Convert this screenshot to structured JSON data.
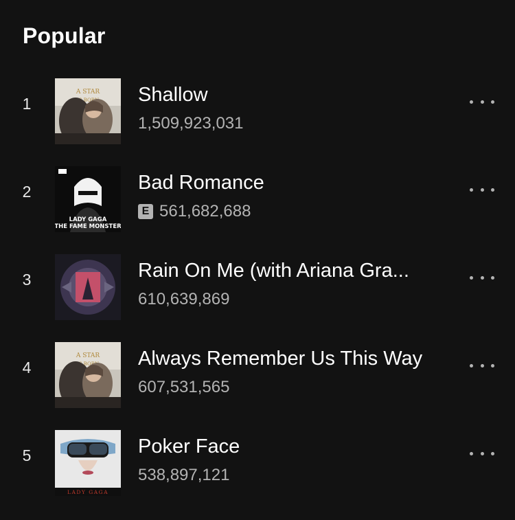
{
  "section": {
    "title": "Popular"
  },
  "tracks": [
    {
      "rank": "1",
      "title": "Shallow",
      "plays": "1,509,923,031",
      "explicit": false,
      "cover": "a-star-is-born"
    },
    {
      "rank": "2",
      "title": "Bad Romance",
      "plays": "561,682,688",
      "explicit": true,
      "explicit_label": "E",
      "cover": "the-fame-monster",
      "cover_text": [
        "LADY GAGA",
        "THE FAME MONSTER"
      ]
    },
    {
      "rank": "3",
      "title": "Rain On Me (with Ariana Gra...",
      "plays": "610,639,869",
      "explicit": false,
      "cover": "chromatica"
    },
    {
      "rank": "4",
      "title": "Always Remember Us This Way",
      "plays": "607,531,565",
      "explicit": false,
      "cover": "a-star-is-born"
    },
    {
      "rank": "5",
      "title": "Poker Face",
      "plays": "538,897,121",
      "explicit": false,
      "cover": "the-fame",
      "cover_text": [
        "LADY GAGA"
      ]
    }
  ],
  "icons": {
    "more": "more-options-icon"
  },
  "colors": {
    "background": "#121212",
    "text": "#ffffff",
    "subtext": "#b3b3b3"
  }
}
